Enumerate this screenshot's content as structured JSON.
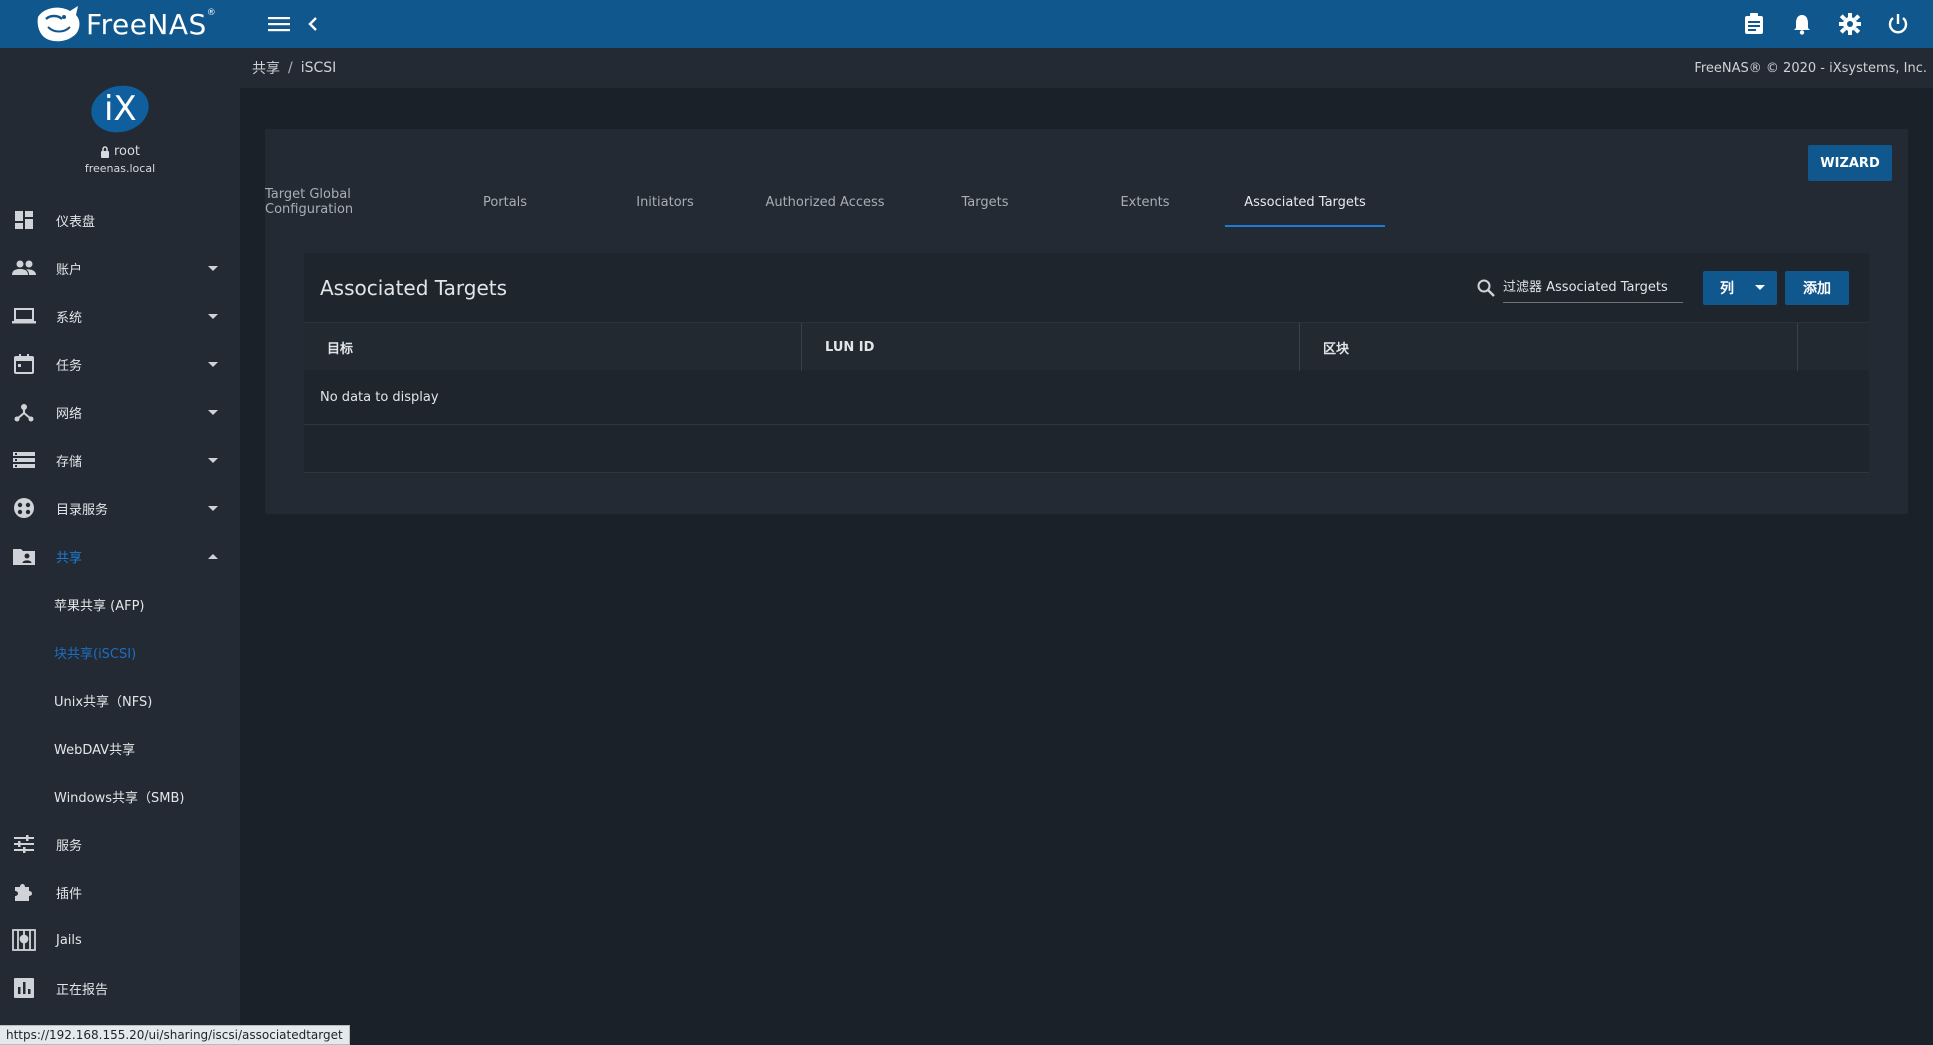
{
  "brand": {
    "name": "FreeNAS",
    "mark": "®"
  },
  "topbar": {
    "icons": [
      "menu-icon",
      "chevron-left-icon",
      "clipboard-icon",
      "bell-icon",
      "gear-icon",
      "power-icon"
    ]
  },
  "profile": {
    "avatar_text": "iX",
    "user": "root",
    "host": "freenas.local"
  },
  "nav": {
    "items": [
      {
        "label": "仪表盘",
        "icon": "dashboard-icon",
        "caret": ""
      },
      {
        "label": "账户",
        "icon": "people-icon",
        "caret": "down"
      },
      {
        "label": "系统",
        "icon": "laptop-icon",
        "caret": "down"
      },
      {
        "label": "任务",
        "icon": "calendar-icon",
        "caret": "down"
      },
      {
        "label": "网络",
        "icon": "network-icon",
        "caret": "down"
      },
      {
        "label": "存储",
        "icon": "storage-icon",
        "caret": "down"
      },
      {
        "label": "目录服务",
        "icon": "directory-icon",
        "caret": "down"
      },
      {
        "label": "共享",
        "icon": "folder-shared-icon",
        "caret": "up",
        "active": true
      }
    ],
    "sharing_sub": [
      {
        "label": "苹果共享 (AFP)"
      },
      {
        "label": "块共享(iSCSI)",
        "active": true
      },
      {
        "label": "Unix共享（NFS)"
      },
      {
        "label": "WebDAV共享"
      },
      {
        "label": "Windows共享（SMB)"
      }
    ],
    "items_after": [
      {
        "label": "服务",
        "icon": "tune-icon"
      },
      {
        "label": "插件",
        "icon": "puzzle-icon"
      },
      {
        "label": "Jails",
        "icon": "jail-icon"
      },
      {
        "label": "正在报告",
        "icon": "chart-icon"
      }
    ]
  },
  "breadcrumb": {
    "parent": "共享",
    "separator": "/",
    "current": "iSCSI",
    "copyright": "FreeNAS® © 2020 - iXsystems, Inc."
  },
  "card": {
    "wizard_label": "WIZARD",
    "tabs": [
      {
        "label": "Target Global Configuration"
      },
      {
        "label": "Portals"
      },
      {
        "label": "Initiators"
      },
      {
        "label": "Authorized Access"
      },
      {
        "label": "Targets"
      },
      {
        "label": "Extents"
      },
      {
        "label": "Associated Targets",
        "active": true
      }
    ]
  },
  "table": {
    "title": "Associated Targets",
    "search_placeholder": "过滤器 Associated Targets",
    "columns_label": "列",
    "add_label": "添加",
    "headers": [
      "目标",
      "LUN ID",
      "区块"
    ],
    "empty_text": "No data to display"
  },
  "status_url": "https://192.168.155.20/ui/sharing/iscsi/associatedtarget",
  "colors": {
    "topbar": "#10578d",
    "sidebar": "#232a33",
    "accent": "#1d7bd6",
    "background": "#1b2129"
  }
}
